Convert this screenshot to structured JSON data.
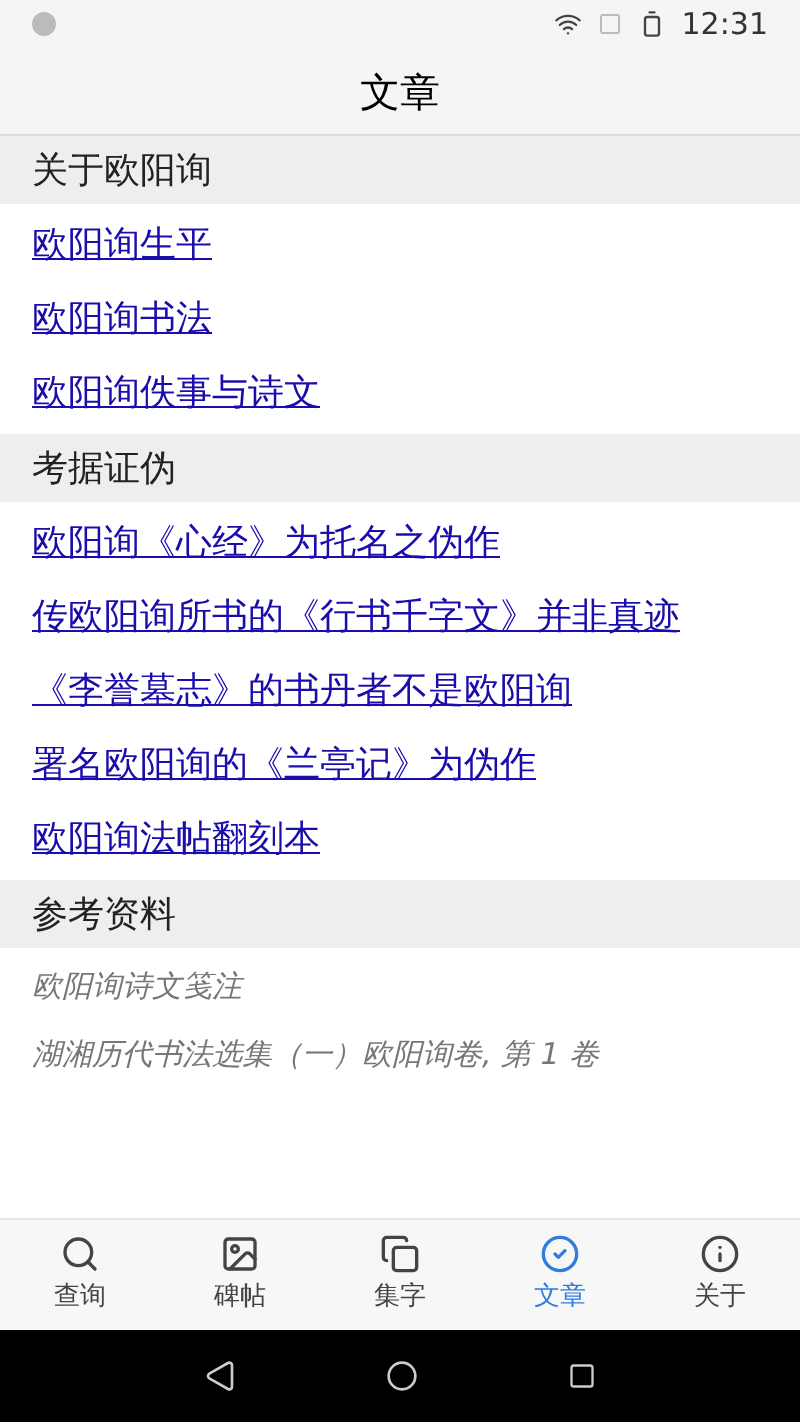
{
  "status_bar": {
    "time": "12:31"
  },
  "title": "文章",
  "sections": [
    {
      "heading": "关于欧阳询",
      "items": [
        {
          "kind": "link",
          "text": "欧阳询生平"
        },
        {
          "kind": "link",
          "text": "欧阳询书法"
        },
        {
          "kind": "link",
          "text": "欧阳询佚事与诗文"
        }
      ]
    },
    {
      "heading": "考据证伪",
      "items": [
        {
          "kind": "link",
          "text": "欧阳询《心经》为托名之伪作"
        },
        {
          "kind": "link",
          "text": "传欧阳询所书的《行书千字文》并非真迹"
        },
        {
          "kind": "link",
          "text": "《李誉墓志》的书丹者不是欧阳询"
        },
        {
          "kind": "link",
          "text": "署名欧阳询的《兰亭记》为伪作"
        },
        {
          "kind": "link",
          "text": "欧阳询法帖翻刻本"
        }
      ]
    },
    {
      "heading": "参考资料",
      "items": [
        {
          "kind": "reference",
          "text": "欧阳询诗文笺注"
        },
        {
          "kind": "reference",
          "text": "湖湘历代书法选集（一）欧阳询卷, 第 1 卷"
        }
      ]
    }
  ],
  "tabs": [
    {
      "label": "查询",
      "selected": false
    },
    {
      "label": "碑帖",
      "selected": false
    },
    {
      "label": "集字",
      "selected": false
    },
    {
      "label": "文章",
      "selected": true
    },
    {
      "label": "关于",
      "selected": false
    }
  ]
}
